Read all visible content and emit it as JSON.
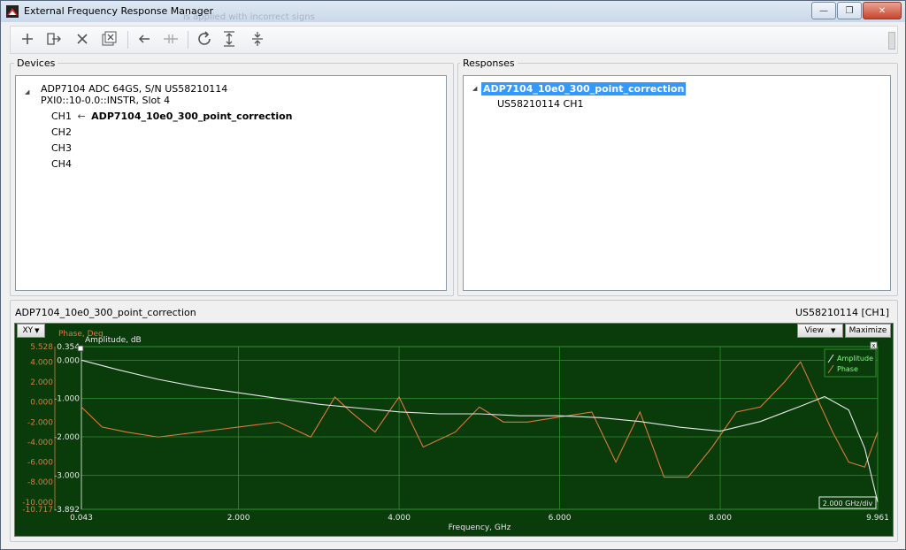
{
  "window": {
    "title": "External Frequency Response Manager",
    "ghost_text": "is applied with incorrect signs"
  },
  "devices": {
    "label": "Devices",
    "device_name": "ADP7104 ADC 64GS, S/N US58210114",
    "device_address": "PXI0::10-0.0::INSTR, Slot 4",
    "channels": [
      {
        "name": "CH1",
        "response": "ADP7104_10e0_300_point_correction"
      },
      {
        "name": "CH2",
        "response": ""
      },
      {
        "name": "CH3",
        "response": ""
      },
      {
        "name": "CH4",
        "response": ""
      }
    ]
  },
  "responses": {
    "label": "Responses",
    "items": [
      {
        "name": "ADP7104_10e0_300_point_correction",
        "children": [
          "US58210114 CH1"
        ]
      }
    ]
  },
  "graph": {
    "title": "ADP7104_10e0_300_point_correction",
    "source": "US58210114 [CH1]",
    "xy_button": "XY",
    "view_button": "View",
    "maximize_button": "Maximize",
    "close_glyph": "x",
    "phase_axis_label": "Phase, Deg",
    "amplitude_axis_label": "Amplitude, dB",
    "x_axis_label": "Frequency, GHz",
    "scale_readout": "2.000 GHz/div",
    "legend": [
      "Amplitude",
      "Phase"
    ],
    "colors": {
      "background": "#0a3b0b",
      "grid": "#2f8f2f",
      "amplitude": "#e8e8e8",
      "phase": "#e07a3a"
    }
  },
  "chart_data": {
    "type": "line",
    "xlabel": "Frequency, GHz",
    "ylabel": "Amplitude, dB",
    "y2label": "Phase, Deg",
    "xlim": [
      0.043,
      9.961
    ],
    "ylim": [
      -3.892,
      0.354
    ],
    "y2lim": [
      -10.717,
      5.528
    ],
    "x_ticks": [
      "0.043",
      "2.000",
      "4.000",
      "6.000",
      "8.000",
      "9.961"
    ],
    "y_ticks": [
      "0.354",
      "0.000",
      "-1.000",
      "-2.000",
      "-3.000",
      "-3.892"
    ],
    "y2_ticks": [
      "5.528",
      "4.000",
      "2.000",
      "0.000",
      "-2.000",
      "-4.000",
      "-6.000",
      "-8.000",
      "-10.000",
      "-10.717"
    ],
    "grid": true,
    "legend_position": "top-right",
    "series": [
      {
        "name": "Amplitude",
        "x": [
          0.043,
          0.5,
          1.0,
          1.5,
          2.0,
          2.5,
          3.0,
          3.5,
          4.0,
          4.5,
          5.0,
          5.5,
          6.0,
          6.5,
          7.0,
          7.5,
          8.0,
          8.5,
          9.0,
          9.3,
          9.6,
          9.8,
          9.961
        ],
        "y": [
          0.0,
          -0.25,
          -0.5,
          -0.7,
          -0.85,
          -1.0,
          -1.15,
          -1.25,
          -1.35,
          -1.4,
          -1.4,
          -1.45,
          -1.45,
          -1.5,
          -1.6,
          -1.75,
          -1.85,
          -1.6,
          -1.2,
          -0.95,
          -1.3,
          -2.3,
          -3.7
        ]
      },
      {
        "name": "Phase",
        "x": [
          0.043,
          0.3,
          0.6,
          1.0,
          1.5,
          2.0,
          2.5,
          2.9,
          3.2,
          3.4,
          3.7,
          4.0,
          4.3,
          4.7,
          5.0,
          5.3,
          5.6,
          6.0,
          6.4,
          6.7,
          7.0,
          7.3,
          7.6,
          7.9,
          8.2,
          8.5,
          8.8,
          9.0,
          9.2,
          9.4,
          9.6,
          9.8,
          9.961
        ],
        "y": [
          -0.5,
          -2.5,
          -3.0,
          -3.5,
          -3.0,
          -2.5,
          -2.0,
          -3.5,
          0.5,
          -1.0,
          -3.0,
          0.5,
          -4.5,
          -3.0,
          -0.5,
          -2.0,
          -2.0,
          -1.5,
          -1.0,
          -6.0,
          -1.0,
          -7.5,
          -7.5,
          -4.5,
          -1.0,
          -0.5,
          2.0,
          4.0,
          0.5,
          -3.0,
          -6.0,
          -6.5,
          -3.0
        ]
      }
    ]
  }
}
